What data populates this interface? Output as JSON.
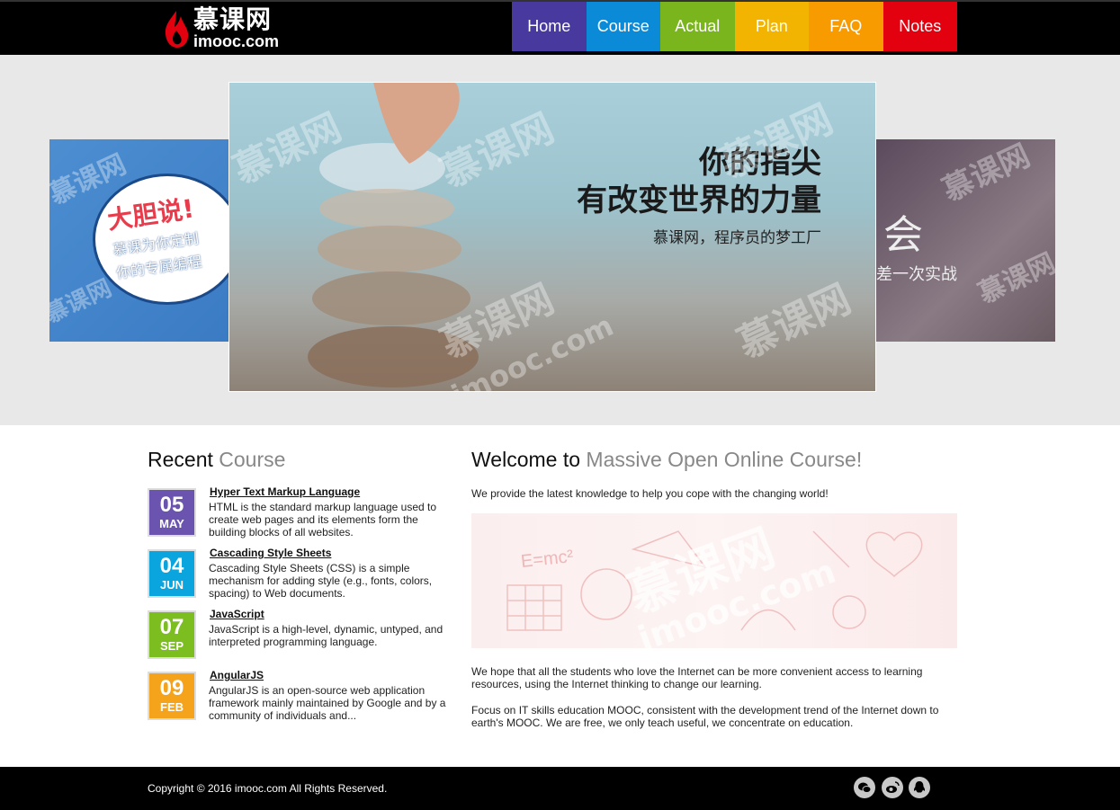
{
  "header": {
    "logo_zh": "慕课网",
    "logo_en": "imooc.com",
    "nav": [
      {
        "label": "Home",
        "color": "#47399e"
      },
      {
        "label": "Course",
        "color": "#0a8ad7"
      },
      {
        "label": "Actual",
        "color": "#7ab51d"
      },
      {
        "label": "Plan",
        "color": "#f2b400"
      },
      {
        "label": "FAQ",
        "color": "#f89b00"
      },
      {
        "label": "Notes",
        "color": "#e3000f"
      }
    ]
  },
  "banner": {
    "left_slide": {
      "line1": "大胆说!",
      "line2": "慕课为你定制",
      "line3": "你的专属编程"
    },
    "main_slide": {
      "line1": "你的指尖",
      "line2": "有改变世界的力量",
      "line3": "慕课网，程序员的梦工厂"
    },
    "right_slide": {
      "line1": "会",
      "line2": "差一次实战"
    },
    "watermark_zh": "慕课网",
    "watermark_en": "imooc.com"
  },
  "recent": {
    "title_prefix": "Recent",
    "title_accent": "Course",
    "courses": [
      {
        "day": "05",
        "month": "MAY",
        "color": "#6a54b0",
        "title": "Hyper Text Markup Language",
        "desc": "HTML is the standard markup language used to create web pages and its elements form the building blocks of all websites."
      },
      {
        "day": "04",
        "month": "JUN",
        "color": "#0aa5de",
        "title": "Cascading Style Sheets",
        "desc": "Cascading Style Sheets (CSS) is a simple mechanism for adding style (e.g., fonts, colors, spacing) to Web documents."
      },
      {
        "day": "07",
        "month": "SEP",
        "color": "#7cbd20",
        "title": "JavaScript",
        "desc": "JavaScript is a high-level, dynamic, untyped, and interpreted programming language."
      },
      {
        "day": "09",
        "month": "FEB",
        "color": "#f5a31a",
        "title": "AngularJS",
        "desc": "AngularJS is an open-source web application framework mainly maintained by Google and by a community of individuals and..."
      }
    ]
  },
  "welcome": {
    "title_prefix": "Welcome to",
    "title_accent": "Massive Open Online Course!",
    "intro": "We provide the latest knowledge to help you cope with the changing world!",
    "image_text": "E=mc²",
    "para1": "We hope that all the students who love the Internet can be more convenient access to learning resources, using the Internet thinking to change our learning.",
    "para2": "Focus on IT skills education MOOC, consistent with the development trend of the Internet down to earth's MOOC. We are free, we only teach useful, we concentrate on education."
  },
  "footer": {
    "copyright": "Copyright © 2016 imooc.com All Rights Reserved.",
    "social": [
      "wechat-icon",
      "weibo-icon",
      "qq-icon"
    ]
  }
}
